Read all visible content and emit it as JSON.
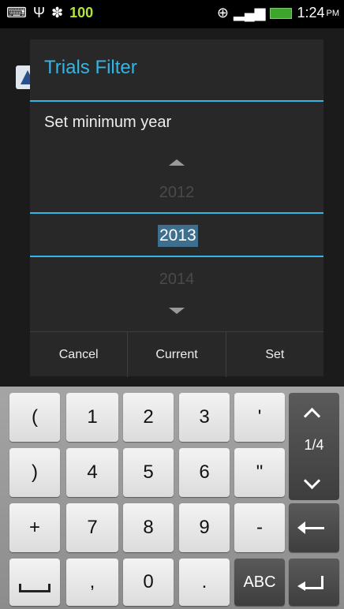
{
  "status_bar": {
    "battery_level": "100",
    "time": "1:24",
    "ampm": "PM",
    "icons": [
      "keyboard-icon",
      "usb-icon",
      "android-debug-icon",
      "gps-icon",
      "signal-icon",
      "battery-icon"
    ]
  },
  "dialog": {
    "title": "Trials Filter",
    "message": "Set minimum year",
    "picker": {
      "previous": "2012",
      "current": "2013",
      "next": "2014"
    },
    "buttons": {
      "cancel": "Cancel",
      "current": "Current",
      "set": "Set"
    }
  },
  "keyboard": {
    "rows": [
      [
        "(",
        "1",
        "2",
        "3",
        "'"
      ],
      [
        ")",
        "4",
        "5",
        "6",
        "\""
      ],
      [
        "+",
        "7",
        "8",
        "9",
        "-"
      ],
      [
        "",
        ",",
        "0",
        ".",
        "ABC"
      ]
    ],
    "page_indicator": "1/4"
  },
  "colors": {
    "accent": "#33b5e5",
    "dialog_bg": "#282828"
  }
}
